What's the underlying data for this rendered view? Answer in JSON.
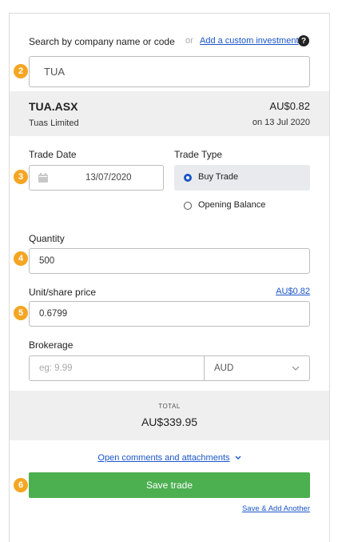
{
  "search": {
    "label": "Search by company name or code",
    "or_text": "or",
    "custom_link": "Add a custom investment",
    "help_icon_text": "?",
    "value": "TUA"
  },
  "security": {
    "code": "TUA.ASX",
    "name": "Tuas Limited",
    "price": "AU$0.82",
    "price_date": "on 13 Jul 2020"
  },
  "trade_date": {
    "label": "Trade Date",
    "value": "13/07/2020"
  },
  "trade_type": {
    "label": "Trade Type",
    "buy": "Buy Trade",
    "opening": "Opening Balance",
    "selected": "buy"
  },
  "quantity": {
    "label": "Quantity",
    "value": "500"
  },
  "unit_price": {
    "label": "Unit/share price",
    "market_link": "AU$0.82",
    "value": "0.6799"
  },
  "brokerage": {
    "label": "Brokerage",
    "placeholder": "eg: 9.99",
    "currency": "AUD"
  },
  "total": {
    "label": "TOTAL",
    "value": "AU$339.95"
  },
  "comments_link": "Open comments and attachments",
  "save_button": "Save trade",
  "save_add_link": "Save & Add Another",
  "steps": [
    "2",
    "3",
    "4",
    "5",
    "6"
  ],
  "colors": {
    "accent": "#f4a623",
    "save": "#4caf50",
    "link": "#1a55c8",
    "radio_selected": "#1a55c8"
  }
}
